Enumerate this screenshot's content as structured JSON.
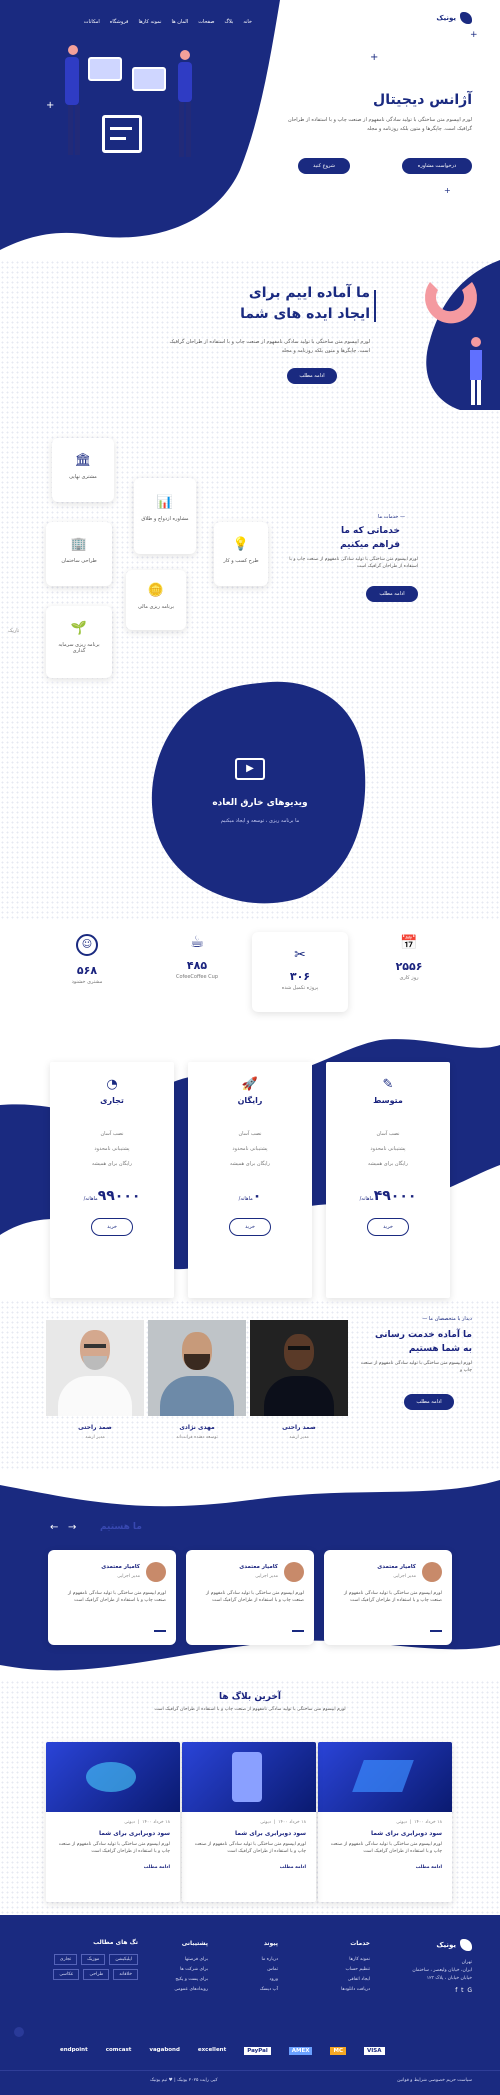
{
  "header": {
    "logo": "یونیک",
    "nav": [
      "خانه",
      "بلاگ",
      "صفحات",
      "المان ها",
      "نمونه کارها",
      "فروشگاه",
      "امکانات"
    ]
  },
  "hero": {
    "title": "آژانس دیجیتال",
    "text": "لورم ایپسوم متن ساختگی با تولید سادگی نامفهوم از صنعت چاپ و با استفاده از طراحان گرافیک است. چاپگرها و متون بلکه روزنامه و مجله",
    "btn_primary": "درخواست مشاوره",
    "btn_secondary": "شروع کنید"
  },
  "about": {
    "title1": "ما آماده اییم برای",
    "title2": "ایجاد ایده های شما",
    "text": "لورم ایپسوم متن ساختگی با تولید سادگی نامفهوم از صنعت چاپ و با استفاده از طراحان گرافیک است. چاپگرها و متون بلکه روزنامه و مجله",
    "btn": "ادامه مطلب"
  },
  "services": {
    "tag": "خدمات ما",
    "title1": "خدماتی که ما",
    "title2": "فراهم میکنیم",
    "text": "لورم ایپسوم متن ساختگی با تولید سادگی نامفهوم از صنعت چاپ و با استفاده از طراحان گرافیک است",
    "btn": "ادامه مطلب",
    "side_label": "تاریک",
    "items": [
      "مشتری نهایی",
      "مشاوره ازدواج و طلاق",
      "طرح کسب و کار",
      "طراحی ساختمان",
      "برنامه ریزی مالی",
      "برنامه ریزی سرمایه گذاری"
    ]
  },
  "video": {
    "title": "ویدیوهای خارق العاده",
    "subtitle": "ما برنامه ریزی ، توسعه و ایجاد میکنیم"
  },
  "stats": [
    {
      "value": "۲۵۵۶",
      "label": "روز کاری"
    },
    {
      "value": "۳۰۶",
      "label": "پروژه تکمیل شده"
    },
    {
      "value": "۴۸۵",
      "label": "CofeeCoffee Cup"
    },
    {
      "value": "۵۶۸",
      "label": "مشتری خشنود"
    }
  ],
  "pricing": {
    "unit": "ماهانه/",
    "features": [
      "نصب آسان",
      "پشتیبانی نامحدود",
      "رایگان برای همیشه"
    ],
    "btn": "خرید",
    "plans": [
      {
        "name": "متوسط",
        "price": "۴۹۰۰۰"
      },
      {
        "name": "رایگان",
        "price": "۰"
      },
      {
        "name": "تجاری",
        "price": "۹۹۰۰۰"
      }
    ]
  },
  "team": {
    "tag": "دیدار با متخصصان ما",
    "title1": "ما آماده خدمت رسانی",
    "title2": "به شما هستیم",
    "text": "لورم ایپسوم متن ساختگی با تولید سادگی نامفهوم از صنعت چاپ و",
    "btn": "ادامه مطلب",
    "members": [
      {
        "name": "صمد راحتی",
        "role": "مدیر ارشد"
      },
      {
        "name": "مهدی نژادی",
        "role": "توسعه دهنده فرانت‌اند"
      },
      {
        "name": "صمد راحتی",
        "role": "مدیر ارشد"
      }
    ]
  },
  "testimonials": {
    "title": "ما هستیم",
    "items": [
      {
        "name": "کامیار معتمدی",
        "role": "مدیر اجرایی",
        "text": "لورم ایپسوم متن ساختگی با تولید سادگی نامفهوم از صنعت چاپ و با استفاده از طراحان گرافیک است"
      },
      {
        "name": "کامیار معتمدی",
        "role": "مدیر اجرایی",
        "text": "لورم ایپسوم متن ساختگی با تولید سادگی نامفهوم از صنعت چاپ و با استفاده از طراحان گرافیک است"
      },
      {
        "name": "کامیار معتمدی",
        "role": "مدیر اجرایی",
        "text": "لورم ایپسوم متن ساختگی با تولید سادگی نامفهوم از صنعت چاپ و با استفاده از طراحان گرافیک است"
      }
    ]
  },
  "blog": {
    "title": "آخرین بلاگ ها",
    "text": "لورم ایپسوم متن ساختگی با تولید سادگی نامفهوم از صنعت چاپ و با استفاده از طراحان گرافیک است",
    "posts": [
      {
        "date": "۱۸ خرداد ۱۴۰۰",
        "cat": "دیوتی",
        "title": "سود دوبرابری برای شما",
        "text": "لورم ایپسوم متن ساختگی با تولید سادگی نامفهوم از صنعت چاپ و با استفاده از طراحان گرافیک است",
        "more": "ادامه مطلب"
      },
      {
        "date": "۱۸ خرداد ۱۴۰۰",
        "cat": "دیوتی",
        "title": "سود دوبرابری برای شما",
        "text": "لورم ایپسوم متن ساختگی با تولید سادگی نامفهوم از صنعت چاپ و با استفاده از طراحان گرافیک است",
        "more": "ادامه مطلب"
      },
      {
        "date": "۱۸ خرداد ۱۴۰۰",
        "cat": "دیوتی",
        "title": "سود دوبرابری برای شما",
        "text": "لورم ایپسوم متن ساختگی با تولید سادگی نامفهوم از صنعت چاپ و با استفاده از طراحان گرافیک است",
        "more": "ادامه مطلب"
      }
    ]
  },
  "footer": {
    "logo": "یونیک",
    "about_lines": [
      "تهران",
      "ایران، خیابان ولیعصر ، ساختمان",
      "خیابان خیابان ، پلاک ۱۲۳"
    ],
    "cols": [
      {
        "title": "خدمات",
        "items": [
          "نمونه کارها",
          "تنظیم حساب",
          "ایجاد اتفاقی",
          "دریافت دانلودها"
        ]
      },
      {
        "title": "پیوند",
        "items": [
          "درباره ما",
          "تماس",
          "ورود",
          "آپ دیسک"
        ]
      },
      {
        "title": "پشتیبانی",
        "items": [
          "برای فرصتها",
          "برای شرکت ها",
          "برای پست و پکیج",
          "رویدادهای عمومی"
        ]
      }
    ],
    "tags_title": "تگ های مطالب",
    "tags": [
      "اپلیکیشن",
      "موزیک",
      "تجاری",
      "خلاقانه",
      "طراحی",
      "عکاسی"
    ],
    "brands": [
      "VISA",
      "MC",
      "AMEX",
      "PayPal",
      "excellent",
      "vagabond",
      "comcast",
      "endpoint"
    ],
    "copyright": "کپی رایت ۲۰۲۵ یونیک | ♥ تیم یونیک",
    "links": "سیاست حریم خصوصی  شرایط و قوانین"
  }
}
